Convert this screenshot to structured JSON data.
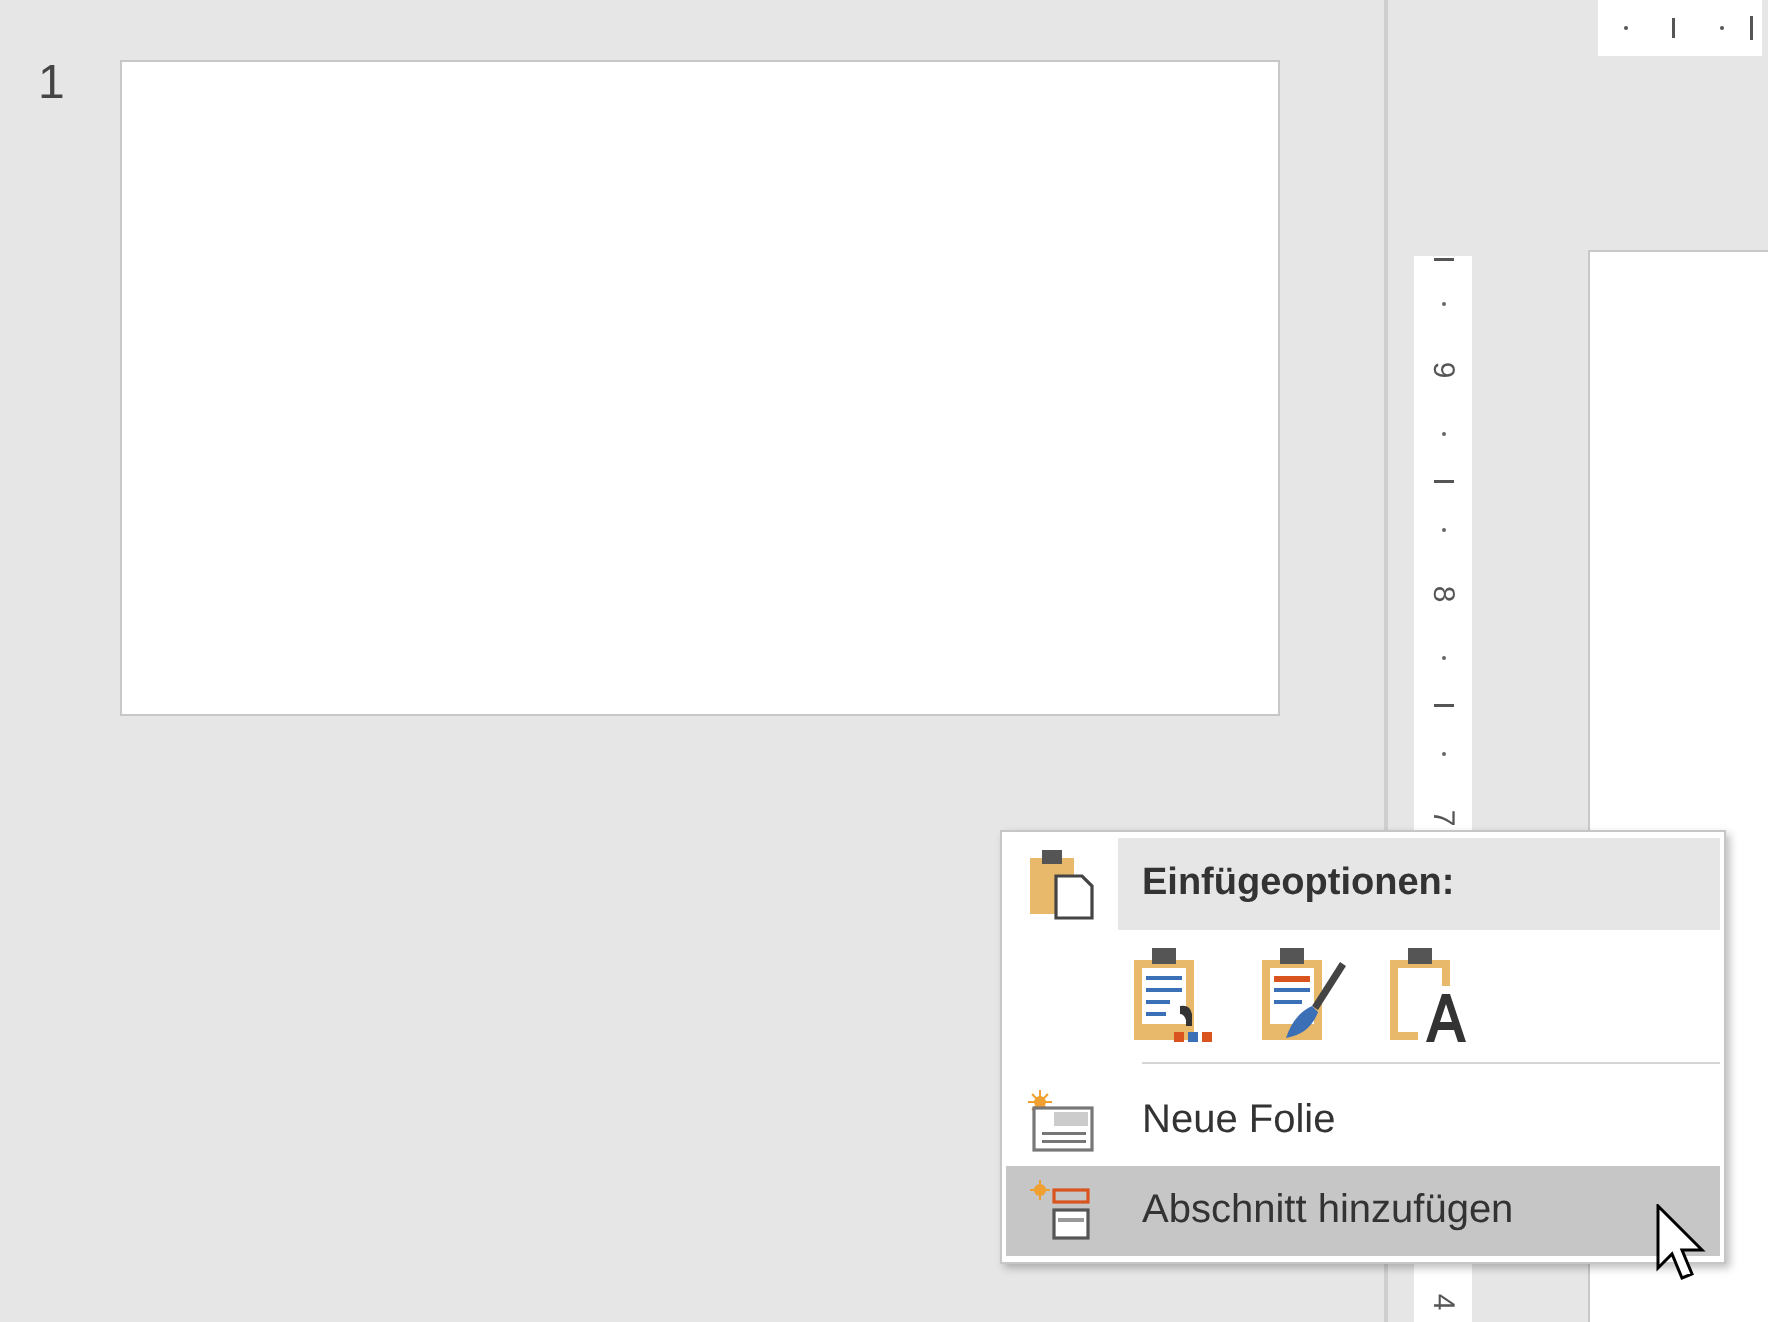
{
  "slide_pane": {
    "slides": [
      {
        "number": "1"
      }
    ]
  },
  "vertical_ruler": {
    "labels": [
      "9",
      "8",
      "7",
      "4"
    ]
  },
  "context_menu": {
    "items": [
      {
        "kind": "header",
        "label": "Einfügeoptionen:"
      },
      {
        "kind": "paste_options"
      },
      {
        "kind": "separator"
      },
      {
        "kind": "new_slide",
        "label": "Neue Folie",
        "selected": false
      },
      {
        "kind": "add_section",
        "label": "Abschnitt hinzufügen",
        "selected": true
      }
    ]
  }
}
